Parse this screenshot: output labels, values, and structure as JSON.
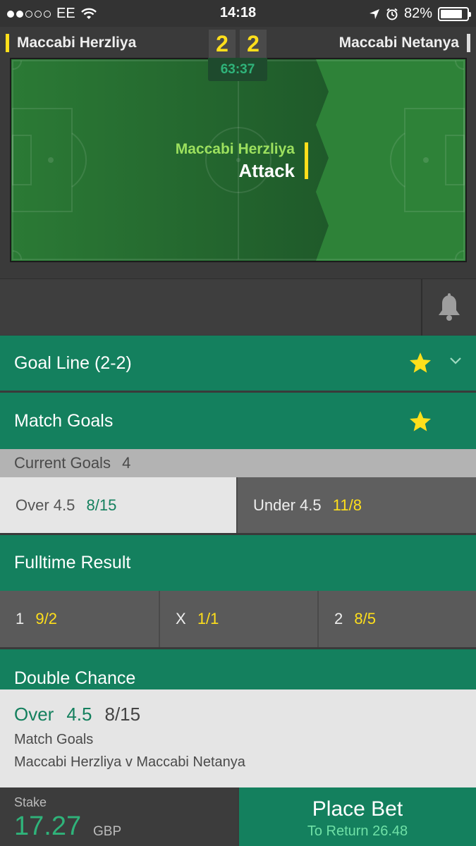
{
  "status_bar": {
    "carrier": "EE",
    "time": "14:18",
    "battery": "82%",
    "battery_level": 0.82,
    "signal_bars_on": 2,
    "signal_bars_total": 5
  },
  "scoreboard": {
    "home_team": "Maccabi Herzliya",
    "away_team": "Maccabi Netanya",
    "home_score": "2",
    "away_score": "2",
    "clock": "63:37"
  },
  "pitch": {
    "attack_team": "Maccabi Herzliya",
    "attack_label": "Attack"
  },
  "markets": {
    "goal_line": {
      "title": "Goal Line (2-2)"
    },
    "match_goals": {
      "title": "Match Goals",
      "current_goals_label": "Current Goals",
      "current_goals_value": "4",
      "over_label": "Over 4.5",
      "over_odds": "8/15",
      "under_label": "Under 4.5",
      "under_odds": "11/8"
    },
    "fulltime_result": {
      "title": "Fulltime Result",
      "home_label": "1",
      "home_odds": "9/2",
      "draw_label": "X",
      "draw_odds": "1/1",
      "away_label": "2",
      "away_odds": "8/5"
    },
    "double_chance": {
      "title": "Double Chance"
    }
  },
  "betslip": {
    "selection": "Over",
    "line": "4.5",
    "odds": "8/15",
    "market": "Match Goals",
    "event": "Maccabi Herzliya v Maccabi Netanya"
  },
  "footer": {
    "stake_label": "Stake",
    "stake_value": "17.27",
    "currency": "GBP",
    "place_bet_label": "Place Bet",
    "to_return": "To Return 26.48"
  },
  "colors": {
    "accent_green": "#14805e",
    "highlight_yellow": "#ffdf1b"
  }
}
